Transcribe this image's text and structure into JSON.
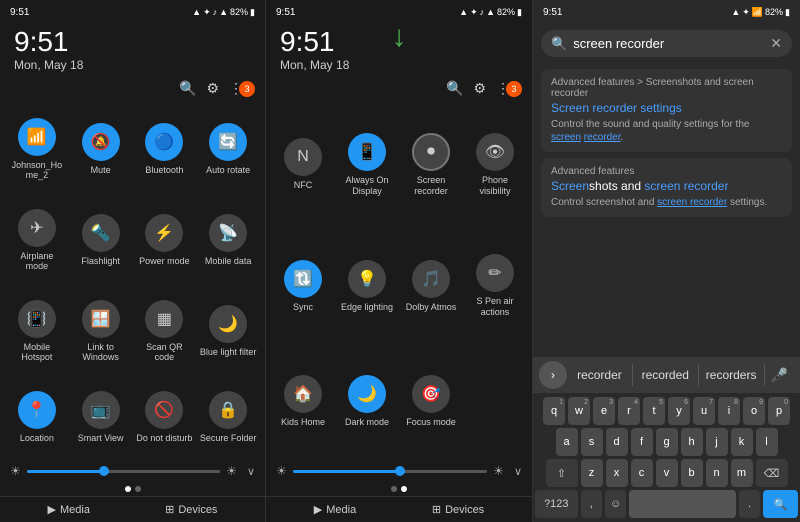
{
  "left_panel": {
    "status": {
      "time": "9:51",
      "date": "Mon, May 18",
      "icons": "▲ ✦ ♪ ▲ 82%"
    },
    "toolbar": {
      "search_label": "🔍",
      "settings_label": "⚙",
      "more_label": "⋮",
      "badge": "3"
    },
    "tiles": [
      {
        "label": "Johnson_Ho me_2",
        "active": true,
        "icon": "wifi"
      },
      {
        "label": "Mute",
        "active": true,
        "icon": "mute"
      },
      {
        "label": "Bluetooth",
        "active": true,
        "icon": "bt"
      },
      {
        "label": "Auto rotate",
        "active": true,
        "icon": "rotate"
      },
      {
        "label": "Airplane mode",
        "active": false,
        "icon": "airplane"
      },
      {
        "label": "Flashlight",
        "active": false,
        "icon": "flashlight"
      },
      {
        "label": "Power mode",
        "active": false,
        "icon": "power"
      },
      {
        "label": "Mobile data",
        "active": false,
        "icon": "data"
      },
      {
        "label": "Mobile Hotspot",
        "active": false,
        "icon": "hotspot"
      },
      {
        "label": "Link to Windows",
        "active": false,
        "icon": "windows"
      },
      {
        "label": "Scan QR code",
        "active": false,
        "icon": "qr"
      },
      {
        "label": "Blue light filter",
        "active": false,
        "icon": "bluelight"
      },
      {
        "label": "Location",
        "active": true,
        "icon": "location"
      },
      {
        "label": "Smart View",
        "active": false,
        "icon": "smartview"
      },
      {
        "label": "Do not disturb",
        "active": false,
        "icon": "dnd"
      },
      {
        "label": "Secure Folder",
        "active": false,
        "icon": "secure"
      }
    ],
    "pagination": [
      true,
      false
    ],
    "bottom": {
      "media_label": "Media",
      "devices_label": "Devices"
    }
  },
  "mid_panel": {
    "status": {
      "time": "9:51",
      "date": "Mon, May 18",
      "icons": "▲ ✦ ♪ ▲ 82%"
    },
    "tiles": [
      {
        "label": "NFC",
        "active": false,
        "icon": "nfc"
      },
      {
        "label": "Always On Display",
        "active": true,
        "icon": "aod"
      },
      {
        "label": "Screen recorder",
        "active": false,
        "icon": "screenrec"
      },
      {
        "label": "Phone visibility",
        "active": false,
        "icon": "phonevis"
      },
      {
        "label": "Sync",
        "active": true,
        "icon": "sync"
      },
      {
        "label": "Edge lighting",
        "active": false,
        "icon": "edge"
      },
      {
        "label": "Dolby Atmos",
        "active": false,
        "icon": "dolby"
      },
      {
        "label": "S Pen air actions",
        "active": false,
        "icon": "spen"
      },
      {
        "label": "Kids Home",
        "active": false,
        "icon": "kids"
      },
      {
        "label": "Dark mode",
        "active": true,
        "icon": "dark"
      },
      {
        "label": "Focus mode",
        "active": false,
        "icon": "focus"
      }
    ],
    "arrow": "↓",
    "pagination": [
      false,
      true
    ],
    "bottom": {
      "media_label": "Media",
      "devices_label": "Devices"
    }
  },
  "right_panel": {
    "search": {
      "placeholder": "screen recorder",
      "value": "screen recorder",
      "clear_label": "✕"
    },
    "results": [
      {
        "path": "Advanced features > Screenshots and screen recorder",
        "title": "Screen recorder settings",
        "title_highlight": [
          "Screen recorder"
        ],
        "desc": "Control the sound and quality settings for the screen recorder.",
        "desc_highlight": [
          "screen",
          "recorder"
        ]
      },
      {
        "path": "Advanced features",
        "title": "Screenshots and screen recorder",
        "title_highlight": [
          "screen recorder"
        ],
        "desc": "Control screenshot and screen recorder settings.",
        "desc_highlight": [
          "screen recorder"
        ]
      }
    ],
    "suggestions": [
      "recorder",
      "recorded",
      "recorders"
    ],
    "keyboard": {
      "row1": [
        "q",
        "w",
        "e",
        "r",
        "t",
        "y",
        "u",
        "i",
        "o",
        "p"
      ],
      "row1_nums": [
        "1",
        "2",
        "3",
        "4",
        "5",
        "6",
        "7",
        "8",
        "9",
        "0"
      ],
      "row2": [
        "a",
        "s",
        "d",
        "f",
        "g",
        "h",
        "j",
        "k",
        "l"
      ],
      "row3": [
        "z",
        "x",
        "c",
        "v",
        "b",
        "n",
        "m"
      ],
      "special_left": "⇧",
      "special_right": "⌫",
      "bottom_left": "?123",
      "bottom_emoji": "☺",
      "bottom_space": " ",
      "bottom_period": ".",
      "bottom_search": "🔍"
    }
  }
}
